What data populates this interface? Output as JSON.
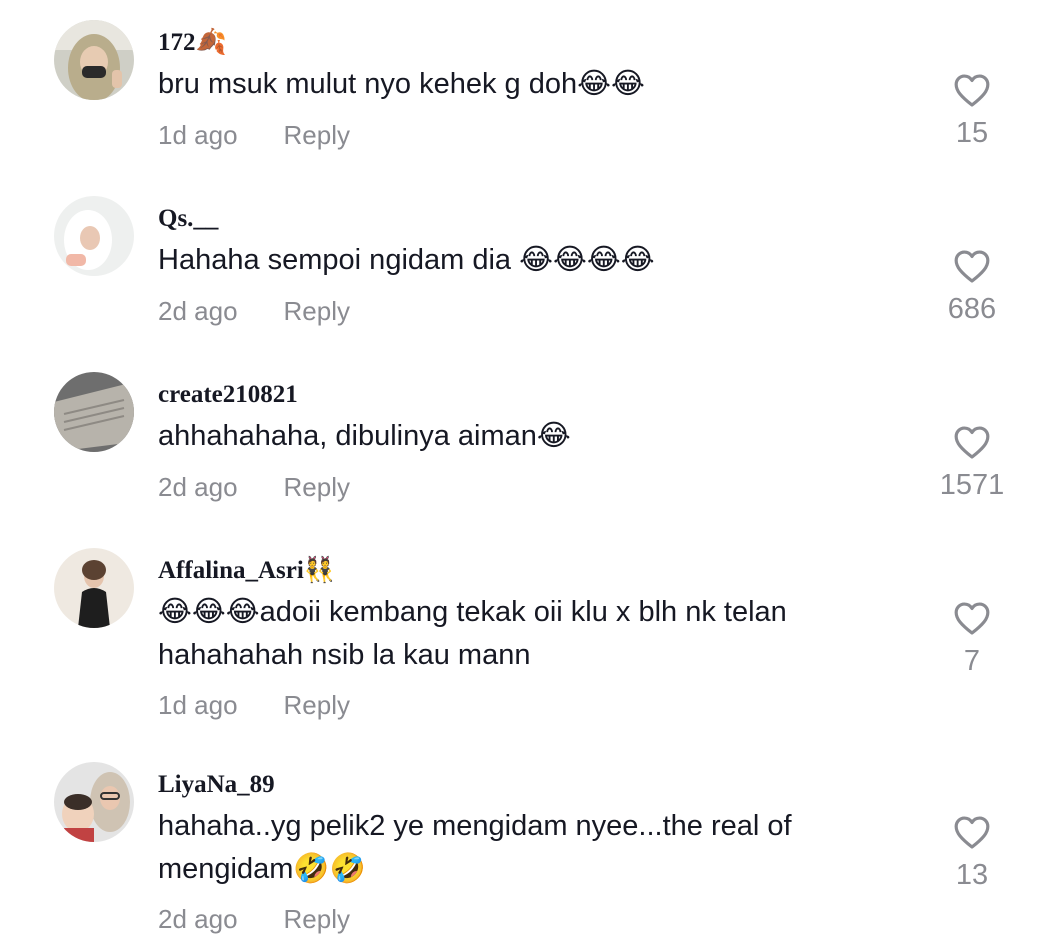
{
  "comments": [
    {
      "username": "172🍂",
      "text": "bru msuk mulut nyo kehek g doh😂😂",
      "time": "1d ago",
      "reply": "Reply",
      "likes": "15"
    },
    {
      "username": "Qs.__",
      "text": "Hahaha sempoi ngidam dia 😂😂😂😂",
      "time": "2d ago",
      "reply": "Reply",
      "likes": "686"
    },
    {
      "username": "create210821",
      "text": "ahhahahaha, dibulinya aiman😂",
      "time": "2d ago",
      "reply": "Reply",
      "likes": "1571"
    },
    {
      "username": "Affalina_Asri👯",
      "text": "😂😂😂adoii kembang tekak oii klu x blh nk telan hahahahah nsib la kau mann",
      "time": "1d ago",
      "reply": "Reply",
      "likes": "7"
    },
    {
      "username": "LiyaNa_89",
      "text": "hahaha..yg pelik2 ye mengidam nyee...the real of mengidam🤣🤣",
      "time": "2d ago",
      "reply": "Reply",
      "likes": "13"
    }
  ],
  "icons": {
    "like": "heart-outline-icon"
  },
  "colors": {
    "primary_text": "#161823",
    "secondary_text": "#8a8b91"
  }
}
